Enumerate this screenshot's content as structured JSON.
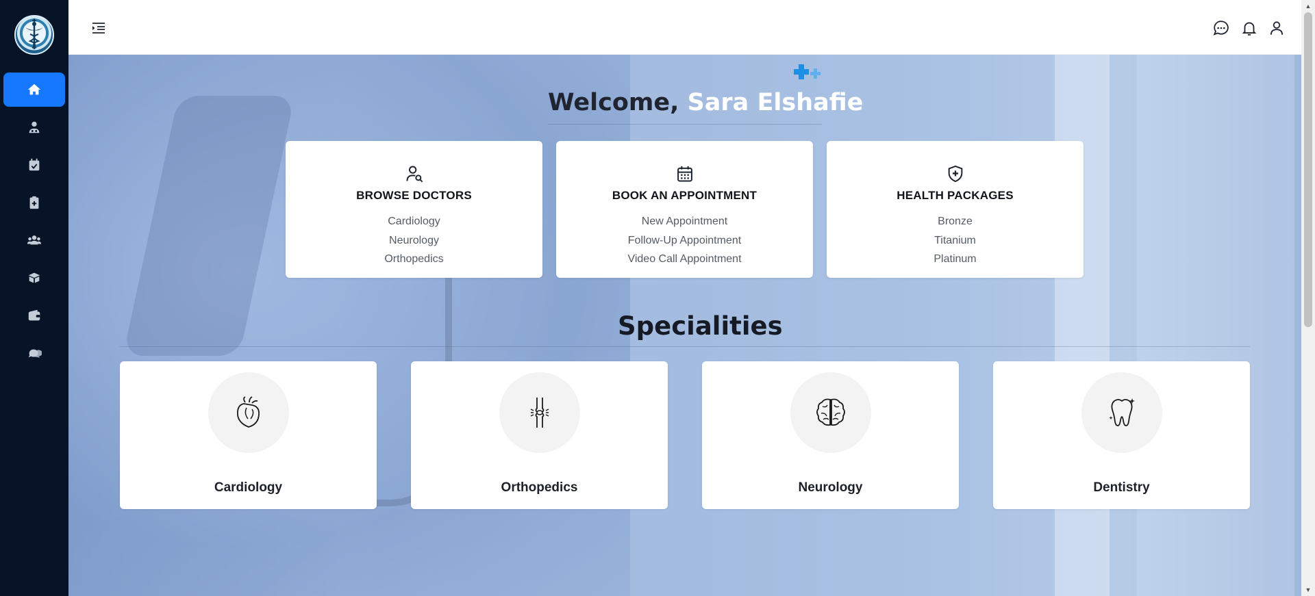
{
  "app": {
    "accent": "#1677ff",
    "sidebar_bg": "#071428"
  },
  "sidebar": {
    "items": [
      {
        "icon": "home-icon",
        "active": true
      },
      {
        "icon": "doctor-icon"
      },
      {
        "icon": "calendar-check-icon"
      },
      {
        "icon": "clipboard-medical-icon"
      },
      {
        "icon": "users-icon"
      },
      {
        "icon": "box-icon"
      },
      {
        "icon": "wallet-icon"
      },
      {
        "icon": "chat-bubbles-icon"
      }
    ]
  },
  "topbar": {
    "icons": [
      "menu-toggle-icon",
      "chat-icon",
      "bell-icon",
      "user-icon"
    ]
  },
  "welcome": {
    "greeting": "Welcome,",
    "name": "Sara Elshafie"
  },
  "quick_cards": [
    {
      "title": "BROWSE DOCTORS",
      "icon": "user-search-icon",
      "items": [
        "Cardiology",
        "Neurology",
        "Orthopedics"
      ]
    },
    {
      "title": "BOOK AN APPOINTMENT",
      "icon": "calendar-icon",
      "items": [
        "New Appointment",
        "Follow-Up Appointment",
        "Video Call Appointment"
      ]
    },
    {
      "title": "HEALTH PACKAGES",
      "icon": "shield-plus-icon",
      "items": [
        "Bronze",
        "Titanium",
        "Platinum"
      ]
    }
  ],
  "specialities": {
    "heading": "Specialities",
    "items": [
      {
        "label": "Cardiology",
        "icon": "heart-organ-icon"
      },
      {
        "label": "Orthopedics",
        "icon": "bone-joint-icon"
      },
      {
        "label": "Neurology",
        "icon": "brain-icon"
      },
      {
        "label": "Dentistry",
        "icon": "tooth-icon"
      }
    ]
  }
}
